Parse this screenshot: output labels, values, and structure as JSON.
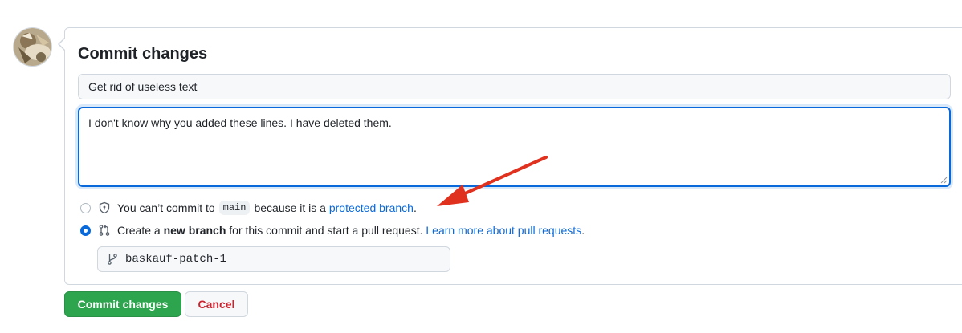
{
  "form": {
    "title": "Commit changes",
    "summary_value": "Get rid of useless text",
    "description_value": "I don't know why you added these lines. I have deleted them."
  },
  "options": {
    "direct": {
      "text_before": "You can’t commit to",
      "branch": "main",
      "text_after": "because it is a",
      "link": "protected branch",
      "end": ".",
      "icon": "shield-lock-icon",
      "selected": false
    },
    "new_branch": {
      "text_before": "Create a",
      "bold": "new branch",
      "text_after": "for this commit and start a pull request.",
      "link": "Learn more about pull requests",
      "end": ".",
      "icon": "git-pull-request-icon",
      "selected": true
    }
  },
  "branch_field": {
    "value": "baskauf-patch-1",
    "icon": "git-branch-icon"
  },
  "buttons": {
    "commit": "Commit changes",
    "cancel": "Cancel"
  },
  "colors": {
    "primary_button": "#2da44e",
    "link": "#0969da",
    "danger": "#cf222e",
    "annotation_arrow": "#e0301e"
  }
}
